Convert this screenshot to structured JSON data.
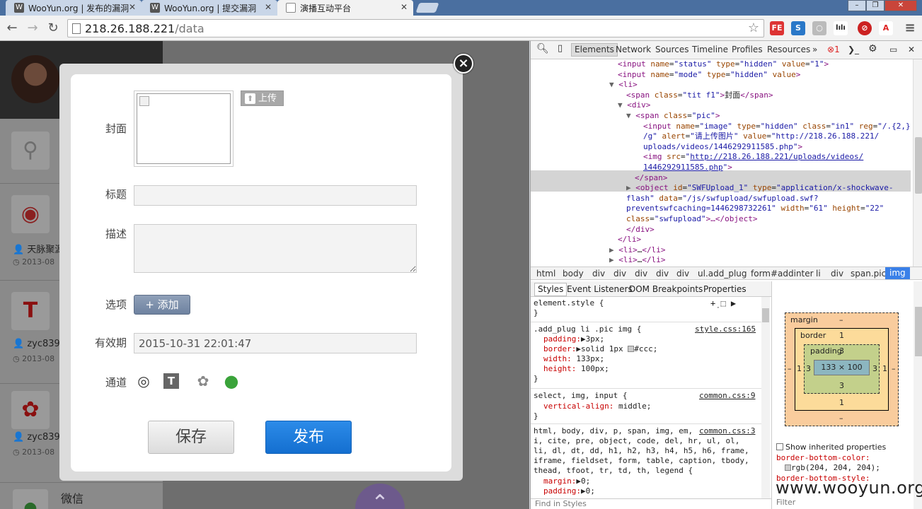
{
  "browser": {
    "tabs": [
      {
        "title": "WooYun.org | 发布的漏洞"
      },
      {
        "title": "WooYun.org | 提交漏洞"
      },
      {
        "title": "演播互动平台"
      }
    ],
    "url_host": "218.26.188.221",
    "url_path": "/data",
    "extensions": [
      "FE",
      "S",
      "○",
      "lılı",
      "⊘",
      "A"
    ]
  },
  "page": {
    "feed": [
      {
        "user": "天脉聚源",
        "date": "2013-08"
      },
      {
        "user": "zyc839",
        "date": "2013-08"
      },
      {
        "user": "zyc839",
        "date": "2013-08"
      }
    ],
    "weixin": "微信"
  },
  "modal": {
    "cover_label": "封面",
    "upload_label": "上传",
    "title_label": "标题",
    "title_value": "",
    "desc_label": "描述",
    "desc_value": "",
    "option_label": "选项",
    "add_label": "+ 添加",
    "validity_label": "有效期",
    "validity_value": "2015-10-31 22:01:47",
    "channel_label": "通道",
    "save_label": "保存",
    "publish_label": "发布",
    "close_glyph": "×"
  },
  "devtools": {
    "tabs": [
      "Elements",
      "Network",
      "Sources",
      "Timeline",
      "Profiles",
      "Resources",
      "»"
    ],
    "error_count": "1",
    "dom": {
      "l1_name": "\"status\"",
      "l1_type": "\"hidden\"",
      "l1_value": "\"1\"",
      "l2_name": "\"mode\"",
      "l2_type": "\"hidden\"",
      "l4_class": "\"tit f1\"",
      "l4_text": "封面",
      "l6_class": "\"pic\"",
      "l7_name": "\"image\"",
      "l7_type": "\"hidden\"",
      "l7_class": "\"in1\"",
      "l7_reg": "\"/.{2,}",
      "l8_reg2": "/g\"",
      "l8_alert": "\"请上传图片\"",
      "l8_value": "\"http://218.26.188.221/",
      "l9_value2": "uploads/videos/1446292911585.php\"",
      "l10_src": "http://218.26.188.221/uploads/videos/",
      "l11_src2": "1446292911585.php",
      "l13_id": "\"SWFUpload_1\"",
      "l13_type": "\"application/x-shockwave-",
      "l14_type2": "flash\"",
      "l14_data": "\"/js/swfupload/swfupload.swf?",
      "l15_data2": "preventswfcaching=1446298732261\"",
      "l15_width": "\"61\"",
      "l15_height": "\"22\"",
      "l16_class": "\"swfupload\"",
      "l16_rest": "…</object>"
    },
    "crumbs": [
      "html",
      "body",
      "div",
      "div",
      "div",
      "div",
      "div",
      "ul.add_plug",
      "form#addinter",
      "li",
      "div",
      "span.pic",
      "img"
    ],
    "subtabs": [
      "Styles",
      "Event Listeners",
      "DOM Breakpoints",
      "Properties"
    ],
    "styles": {
      "element_style": "element.style {",
      "r1_selector": ".add_plug li .pic img {",
      "r1_source": "style.css:165",
      "r1_padding": "3px;",
      "r1_border": "solid 1px",
      "r1_border_color": "#ccc;",
      "r1_width": "133px;",
      "r1_height": "100px;",
      "r2_selector": "select, img, input {",
      "r2_source": "common.css:9",
      "r2_prop": "vertical-align:",
      "r2_val": "middle;",
      "r3_l1": "html, body, div, p, span, img, em,",
      "r3_source": "common.css:3",
      "r3_l2": "i, cite, pre, object, code, del, hr, ul, ol,",
      "r3_l3": "li, dl, dt, dd, h1, h2, h3, h4, h5, h6, frame,",
      "r3_l4": "iframe, fieldset, form, table, caption, tbody,",
      "r3_l5": "thead, tfoot, tr, td, th, legend {",
      "r3_margin": "0;",
      "r3_padding": "0;",
      "find": "Find in Styles"
    },
    "boxmodel": {
      "margin_label": "margin",
      "margin_top": "–",
      "margin_bottom": "–",
      "margin_left": "–",
      "margin_right": "–",
      "border_label": "border",
      "border_top": "1",
      "border_bottom": "1",
      "border_left": "1",
      "border_right": "1",
      "padding_label": "padding",
      "padding_top": "3",
      "padding_bottom": "3",
      "padding_left": "3",
      "padding_right": "3",
      "content": "133 × 100",
      "inherited_label": "Show inherited properties",
      "inh1_prop": "border-bottom-color:",
      "inh1_val": "rgb(204, 204, 204);",
      "inh2_prop": "border-bottom-style:",
      "filter": "Filter"
    }
  },
  "watermark": "www.wooyun.org"
}
